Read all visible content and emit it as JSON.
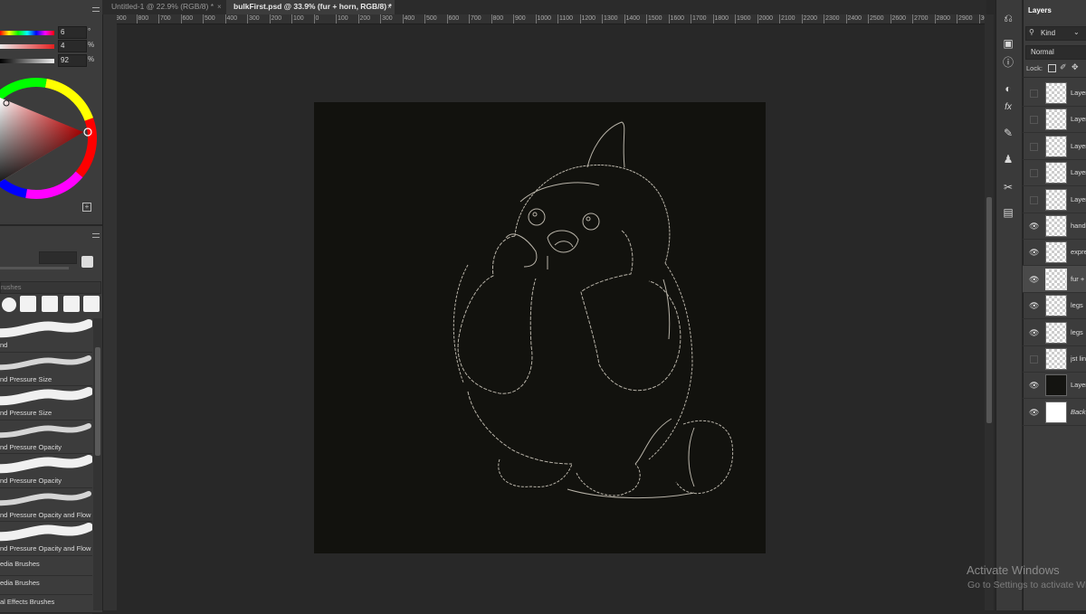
{
  "tabs": [
    {
      "label": "Untitled-1 @ 22.9% (RGB/8) *",
      "active": false
    },
    {
      "label": "bulkFirst.psd @ 33.9% (fur + horn, RGB/8) *",
      "active": true
    }
  ],
  "ruler_ticks": [
    "900",
    "800",
    "700",
    "600",
    "500",
    "400",
    "300",
    "200",
    "100",
    "0",
    "100",
    "200",
    "300",
    "400",
    "500",
    "600",
    "700",
    "800",
    "900",
    "1000",
    "1100",
    "1200",
    "1300",
    "1400",
    "1500",
    "1600",
    "1700",
    "1800",
    "1900",
    "2000",
    "2100",
    "2200",
    "2300",
    "2400",
    "2500",
    "2600",
    "2700",
    "2800",
    "2900",
    "3000"
  ],
  "color": {
    "hue": {
      "value": "6",
      "unit": "°"
    },
    "saturation": {
      "value": "4",
      "unit": "%"
    },
    "brightness": {
      "value": "92",
      "unit": "%"
    }
  },
  "brushes": {
    "search_placeholder": "rushes",
    "items": [
      {
        "label": "nd"
      },
      {
        "label": "nd Pressure Size"
      },
      {
        "label": "nd Pressure Size"
      },
      {
        "label": "nd Pressure Opacity"
      },
      {
        "label": "nd Pressure Opacity"
      },
      {
        "label": "nd Pressure Opacity and Flow"
      },
      {
        "label": "nd Pressure Opacity and Flow"
      }
    ],
    "groups": [
      {
        "label": "edia Brushes"
      },
      {
        "label": "edia Brushes"
      },
      {
        "label": "al Effects Brushes"
      }
    ]
  },
  "layers_panel": {
    "title": "Layers",
    "filter_label": "Kind",
    "blend_mode": "Normal",
    "lock_label": "Lock:",
    "layers": [
      {
        "name": "Layer",
        "visible": false
      },
      {
        "name": "Layer",
        "visible": false
      },
      {
        "name": "Layer",
        "visible": false
      },
      {
        "name": "Layer",
        "visible": false
      },
      {
        "name": "Layer",
        "visible": false
      },
      {
        "name": "hand",
        "visible": true
      },
      {
        "name": "expre",
        "visible": true
      },
      {
        "name": "fur +",
        "visible": true,
        "selected": true
      },
      {
        "name": "legs",
        "visible": true
      },
      {
        "name": "legs",
        "visible": true
      },
      {
        "name": "jst lin",
        "visible": false
      },
      {
        "name": "Layer",
        "visible": true
      },
      {
        "name": "Backg",
        "visible": true
      }
    ]
  },
  "watermark": {
    "title": "Activate Windows",
    "subtitle": "Go to Settings to activate Wi"
  },
  "colors": {
    "canvas": "#12120e",
    "workspace": "#282828",
    "panel": "#3c3c3c",
    "line_art": "#b8b3a8"
  }
}
